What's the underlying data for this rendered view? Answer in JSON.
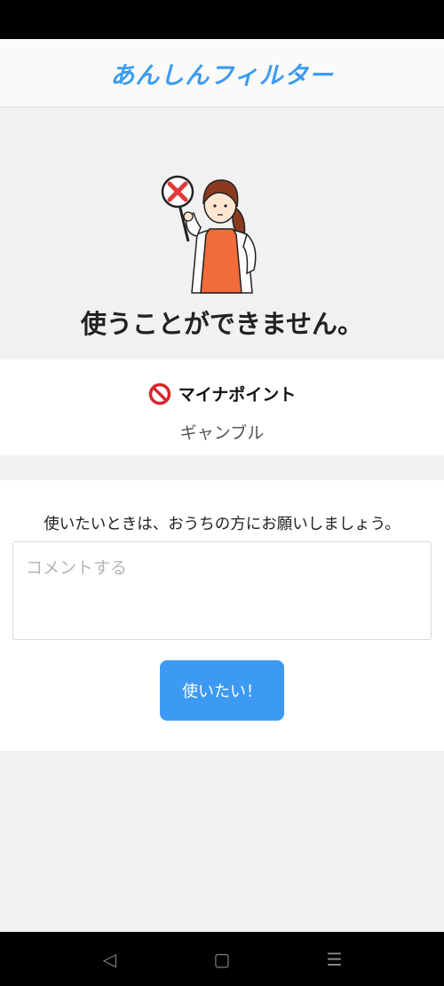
{
  "header": {
    "title": "あんしんフィルター"
  },
  "hero": {
    "heading": "使うことができません。"
  },
  "blocked_site": {
    "name": "マイナポイント",
    "category": "ギャンブル"
  },
  "request": {
    "message": "使いたいときは、おうちの方にお願いしましょう。",
    "comment_placeholder": "コメントする",
    "button_label": "使いたい！"
  },
  "nav": {
    "back_glyph": "◁",
    "home_glyph": "▢",
    "menu_glyph": "☰"
  },
  "colors": {
    "accent": "#3d9af3",
    "title": "#3c9bf0",
    "block_red": "#d9262c",
    "apron": "#f26b3a"
  }
}
